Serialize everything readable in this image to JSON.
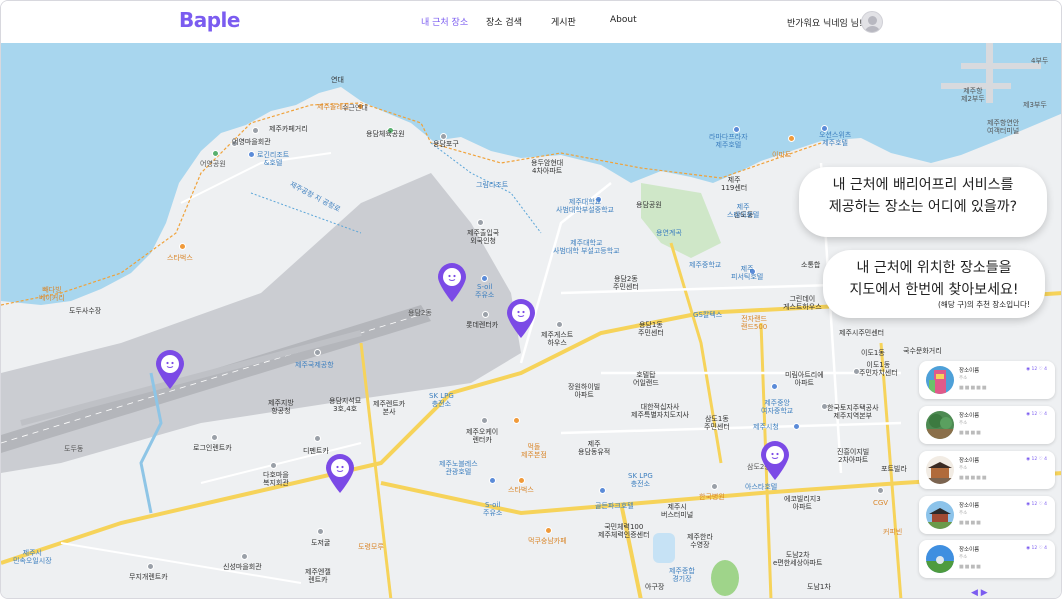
{
  "header": {
    "logo": "Baple",
    "nav": [
      "내 근처 장소",
      "장소 검색",
      "게시판",
      "About"
    ],
    "greeting": "반가워요 닉네임 님!"
  },
  "bubbles": [
    {
      "line1": "내 근처에 배리어프리 서비스를",
      "line2": "제공하는 장소는 어디에 있을까?"
    },
    {
      "line1": "내 근처에 위치한 장소들을",
      "line2": "지도에서 한번에 찾아보세요!"
    }
  ],
  "panel": {
    "title": "(해당 구)의 추천 장소입니다!",
    "cards": [
      {
        "name": "장소이름",
        "meta": "주소",
        "chips": "■■■■■",
        "stats": "◉ 12  ♡ 4",
        "thumb": "colorful-tower"
      },
      {
        "name": "장소이름",
        "meta": "주소",
        "chips": "■■■■",
        "stats": "◉ 12  ♡ 4",
        "thumb": "park"
      },
      {
        "name": "장소이름",
        "meta": "주소",
        "chips": "■■■■■",
        "stats": "◉ 12  ♡ 4",
        "thumb": "hanok"
      },
      {
        "name": "장소이름",
        "meta": "주소",
        "chips": "■■■■",
        "stats": "◉ 12  ♡ 4",
        "thumb": "palace"
      },
      {
        "name": "장소이름",
        "meta": "주소",
        "chips": "■■■■",
        "stats": "◉ 12  ♡ 4",
        "thumb": "blue-sky-field"
      }
    ],
    "pager": "◀  ▶"
  },
  "map_labels": {
    "l1": "연대",
    "l2": "제주올레길",
    "l3": "수근연대",
    "l4": "제주카페거리",
    "l5": "어영마을회관",
    "l6": "어영공원",
    "l7": "로긴리조트\n&호텔",
    "l8": "용담체육공원",
    "l9": "용담포구",
    "l10": "용두암현대\n4차아파트",
    "l11": "그림리조트",
    "l12": "제주대학교\n사범대학부설중학교",
    "l13": "제주대학교\n사범대학 부설고등학교",
    "l14": "용담로",
    "l15": "용담공원",
    "l16": "용연계곡",
    "l17": "제주출입국\n외국인청",
    "l18": "S-oil\n주유소",
    "l19": "롯데렌터카",
    "l20": "용담2동",
    "l21": "제주게스트\n하우스",
    "l22": "용담2동\n주민센터",
    "l23": "용담1동\n주민센터",
    "l24": "제주국제공항",
    "l25": "제주지방\n항공청",
    "l26": "용담지석묘\n3호,4호",
    "l27": "제주렌트카\n본사",
    "l28": "SK LPG\n충전소",
    "l29": "로그인렌트카",
    "l30": "디펜트카",
    "l31": "다호마을\n복지회관",
    "l32": "도두동",
    "l33": "제주오케이\n렌터카",
    "l34": "제주노블레스\n관광호텔",
    "l35": "먹돌\n제주본점",
    "l36": "스타벅스",
    "l37": "S-oil\n주유소",
    "l38": "제주\n용담동유적",
    "l39": "SK LPG\n충전소",
    "l40": "골든파크호텔",
    "l41": "제주시\n버스터미널",
    "l42": "도저굴",
    "l43": "도령모루",
    "l44": "제주엔젤\n렌트카",
    "l45": "신성마을회관",
    "l46": "무지개렌트카",
    "l47": "제주시\n민속오일시장",
    "l48": "먹쿠숭남카페",
    "l49": "국민체력100\n제주체력인증센터",
    "l50": "제주한라\n수영장",
    "l51": "제주종합\n경기장",
    "l52": "장원하이빌\n아파트",
    "l53": "호텔탑\n어일랜드",
    "l54": "대한적십자사\n제주특별자치도지사",
    "l55": "삼도1동\n주민센터",
    "l56": "제주중앙\n여자중학교",
    "l57": "제주시청",
    "l58": "이도1동\n주민자치센터",
    "l59": "한국토지주택공사\n제주지역본부",
    "l60": "진흥이지빌\n2차아파트",
    "l61": "포트빌라",
    "l62": "한국병원",
    "l63": "에코빌리지3\n아파트",
    "l64": "도남2차\n e편한세상아파트",
    "l65": "도남1차",
    "l66": "CGV",
    "l67": "커피빈",
    "l68": "삼도2동",
    "l69": "라마다프라자\n제주호텔",
    "l70": "오션스위츠\n제주호텔",
    "l71": "이마트",
    "l72": "제주\n119센터",
    "l73": "제주중학교",
    "l74": "제주\n피서틱호텔",
    "l75": "전자랜드\n랜드500",
    "l76": "GS칼텍스",
    "l77": "그린데이\n게스트하우스",
    "l78": "미림아트리에\n아파트",
    "l79": "아스타호텔",
    "l80": "제주항\n제2부두",
    "l81": "제주항연안\n여객터미널",
    "l82": "제3부두",
    "l83": "4부두",
    "l84": "스타벅스",
    "l85": "도두사수장",
    "l86": "빼다빙\n베이커리",
    "l87": "제주공항 지 공항로",
    "l88": "삼도동",
    "l89": "제주\n스테이호텔",
    "l90": "소통합",
    "l91": "국수문화거리",
    "l92": "제주그랜드",
    "l93": "도남1차",
    "l94": "0파크",
    "l95": "제주시주민센터",
    "l96": "아구장",
    "l97": "이도1동"
  },
  "colors": {
    "accent": "#7b5cf0",
    "sea": "#a8d6ee",
    "land": "#eef0f2",
    "airport": "#cbcdd2",
    "road_major": "#f6d35a"
  }
}
